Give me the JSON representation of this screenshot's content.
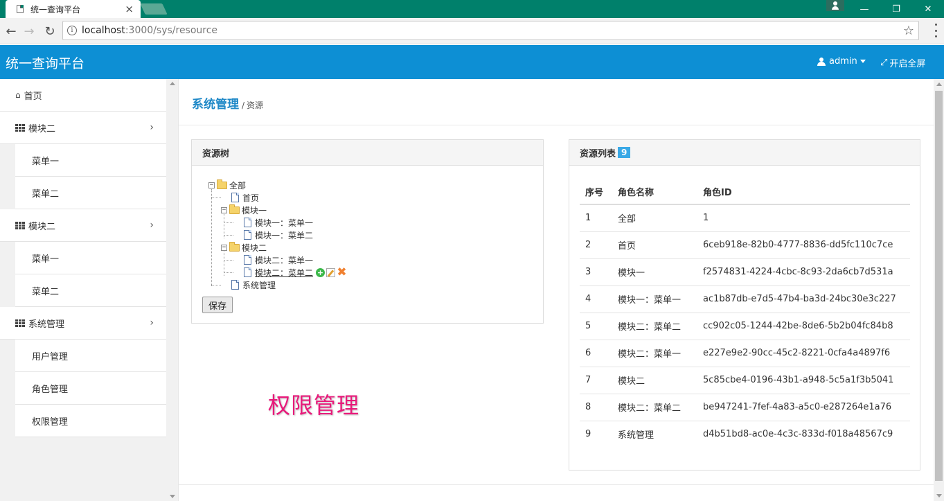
{
  "browser": {
    "tab_title": "统一查询平台",
    "tab_close": "×",
    "url_host": "localhost",
    "url_path": ":3000/sys/resource",
    "window_controls": [
      "—",
      "❐",
      "✕"
    ]
  },
  "header": {
    "brand": "统一查询平台",
    "user": "admin",
    "fullscreen": "开启全屏"
  },
  "sidebar": {
    "home": "首页",
    "group1": {
      "label": "模块二",
      "items": [
        "菜单一",
        "菜单二"
      ]
    },
    "group2": {
      "label": "模块二",
      "items": [
        "菜单一",
        "菜单二"
      ]
    },
    "group3": {
      "label": "系统管理",
      "items": [
        "用户管理",
        "角色管理",
        "权限管理"
      ]
    }
  },
  "breadcrumb": {
    "main": "系统管理",
    "sep": "/",
    "sub": "资源"
  },
  "tree_panel": {
    "title": "资源树",
    "nodes": {
      "root": "全部",
      "home": "首页",
      "m1": "模块一",
      "m1c1": "模块一：菜单一",
      "m1c2": "模块一：菜单二",
      "m2": "模块二",
      "m2c1": "模块二：菜单一",
      "m2c2": "模块二：菜单二",
      "sys": "系统管理"
    },
    "save_label": "保存"
  },
  "watermark": "权限管理",
  "list_panel": {
    "title": "资源列表",
    "count": "9",
    "columns": [
      "序号",
      "角色名称",
      "角色ID"
    ],
    "rows": [
      [
        "1",
        "全部",
        "1"
      ],
      [
        "2",
        "首页",
        "6ceb918e-82b0-4777-8836-dd5fc110c7ce"
      ],
      [
        "3",
        "模块一",
        "f2574831-4224-4cbc-8c93-2da6cb7d531a"
      ],
      [
        "4",
        "模块一：菜单一",
        "ac1b87db-e7d5-47b4-ba3d-24bc30e3c227"
      ],
      [
        "5",
        "模块二：菜单二",
        "cc902c05-1244-42be-8de6-5b2b04fc84b8"
      ],
      [
        "6",
        "模块二：菜单一",
        "e227e9e2-90cc-45c2-8221-0cfa4a4897f6"
      ],
      [
        "7",
        "模块二",
        "5c85cbe4-0196-43b1-a948-5c5a1f3b5041"
      ],
      [
        "8",
        "模块二：菜单二",
        "be947241-7fef-4a83-a5c0-e287264e1a76"
      ],
      [
        "9",
        "系统管理",
        "d4b51bd8-ac0e-4c3c-833d-f018a48567c9"
      ]
    ]
  },
  "colors": {
    "header_bg": "#0d8fd4",
    "titlebar_bg": "#00806b",
    "breadcrumb": "#1e88c7",
    "badge": "#3aa9e6",
    "watermark": "#e8197a"
  }
}
